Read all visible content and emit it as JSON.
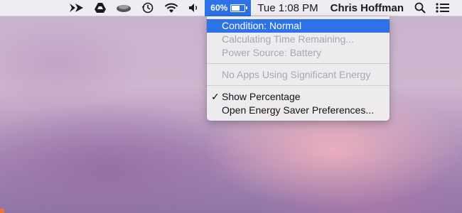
{
  "menubar": {
    "status_icons": [
      {
        "name": "arrow-app-icon"
      },
      {
        "name": "google-drive-icon"
      },
      {
        "name": "cloud-drive-icon"
      },
      {
        "name": "time-machine-icon"
      },
      {
        "name": "wifi-icon"
      },
      {
        "name": "volume-icon"
      }
    ],
    "battery": {
      "percent_label": "60%",
      "level": 0.6
    },
    "clock": "Tue 1:08 PM",
    "user": "Chris Hoffman",
    "right_icons": [
      "spotlight-search-icon",
      "notification-center-icon"
    ],
    "accent_color": "#2d72e6"
  },
  "battery_menu": {
    "items": [
      {
        "label": "Condition: Normal",
        "state": "highlighted"
      },
      {
        "label": "Calculating Time Remaining...",
        "state": "disabled"
      },
      {
        "label": "Power Source: Battery",
        "state": "disabled"
      },
      {
        "label": "No Apps Using Significant Energy",
        "state": "disabled"
      },
      {
        "label": "Show Percentage",
        "state": "checked"
      },
      {
        "label": "Open Energy Saver Preferences...",
        "state": "enabled"
      }
    ]
  }
}
